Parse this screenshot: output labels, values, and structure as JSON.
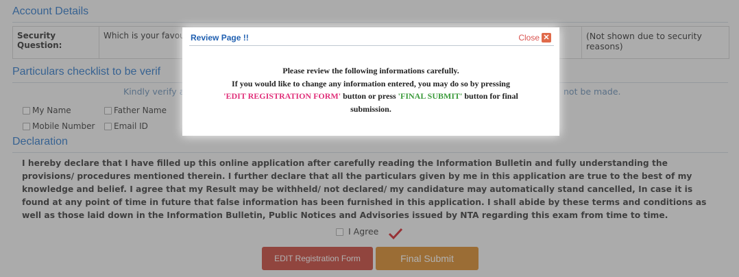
{
  "account": {
    "title": "Account Details",
    "security_label": "Security Question:",
    "security_value": "Which is your favou",
    "security_note": "(Not shown due to security reasons)"
  },
  "checklist": {
    "title": "Particulars checklist to be verif",
    "instruction_left": "Kindly verify a",
    "instruction_right": "not be made.",
    "items": [
      "My Name",
      "Father Name",
      "Mobile Number",
      "Email ID"
    ]
  },
  "declaration": {
    "title": "Declaration",
    "text": "I hereby declare that I have filled up this online application after carefully reading the Information Bulletin and fully understanding the provisions/ procedures mentioned therein. I further declare that all the particulars given by me in this application are true to the best of my knowledge and belief. I agree that my Result may be withheld/ not declared/ my candidature may automatically stand cancelled, In case it is found at any point of time in future that false information has been furnished in this application. I shall abide by these terms and conditions as well as those laid down in the Information Bulletin, Public Notices and Advisories issued by NTA regarding this exam from time to time.",
    "agree_label": "I Agree"
  },
  "buttons": {
    "edit": "EDIT Registration Form",
    "final": "Final Submit"
  },
  "modal": {
    "title": "Review Page !!",
    "close_label": "Close",
    "line1": "Please review the following informations carefully.",
    "line2": "If you would like to change any information entered, you may do so by pressing",
    "edit_term": "'EDIT REGISTRATION FORM'",
    "mid": " button or press ",
    "final_term": "'FINAL SUBMIT'",
    "end": " button for final submission."
  }
}
